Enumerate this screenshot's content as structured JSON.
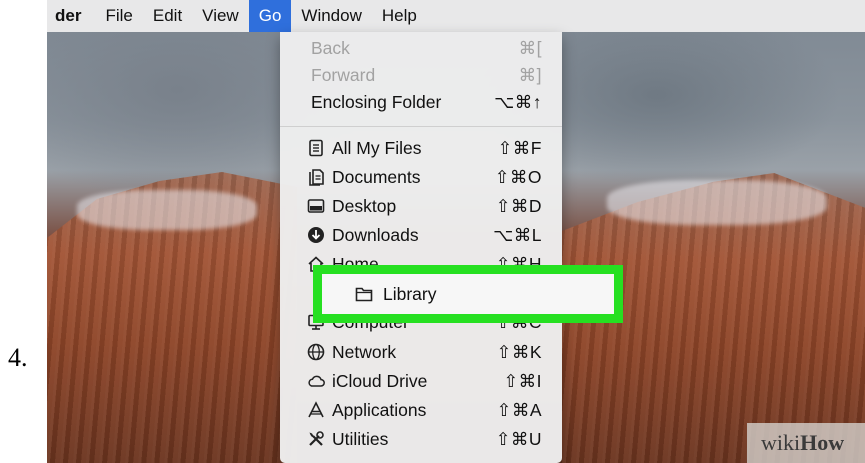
{
  "step_number": "4.",
  "menubar": {
    "app_name": "der",
    "items": [
      "File",
      "Edit",
      "View",
      "Go",
      "Window",
      "Help"
    ],
    "active": "Go"
  },
  "go_menu": {
    "items": [
      {
        "label": "Back",
        "shortcut": "⌘[",
        "disabled": true,
        "icon": ""
      },
      {
        "label": "Forward",
        "shortcut": "⌘]",
        "disabled": true,
        "icon": ""
      },
      {
        "label": "Enclosing Folder",
        "shortcut": "⌥⌘↑",
        "disabled": false,
        "icon": ""
      },
      {
        "label": "All My Files",
        "shortcut": "⇧⌘F",
        "disabled": false,
        "icon": "all-files-icon"
      },
      {
        "label": "Documents",
        "shortcut": "⇧⌘O",
        "disabled": false,
        "icon": "documents-icon"
      },
      {
        "label": "Desktop",
        "shortcut": "⇧⌘D",
        "disabled": false,
        "icon": "desktop-icon"
      },
      {
        "label": "Downloads",
        "shortcut": "⌥⌘L",
        "disabled": false,
        "icon": "downloads-icon"
      },
      {
        "label": "Home",
        "shortcut": "⇧⌘H",
        "disabled": false,
        "icon": "home-icon"
      },
      {
        "label": "Library",
        "shortcut": "",
        "disabled": false,
        "icon": "library-folder-icon"
      },
      {
        "label": "Computer",
        "shortcut": "⇧⌘C",
        "disabled": false,
        "icon": "computer-icon"
      },
      {
        "label": "Network",
        "shortcut": "⇧⌘K",
        "disabled": false,
        "icon": "network-icon"
      },
      {
        "label": "iCloud Drive",
        "shortcut": "⇧⌘I",
        "disabled": false,
        "icon": "icloud-icon"
      },
      {
        "label": "Applications",
        "shortcut": "⇧⌘A",
        "disabled": false,
        "icon": "applications-icon"
      },
      {
        "label": "Utilities",
        "shortcut": "⇧⌘U",
        "disabled": false,
        "icon": "utilities-icon"
      }
    ]
  },
  "highlight_color": "#26e021",
  "watermark": {
    "part1": "wiki",
    "part2": "How"
  }
}
